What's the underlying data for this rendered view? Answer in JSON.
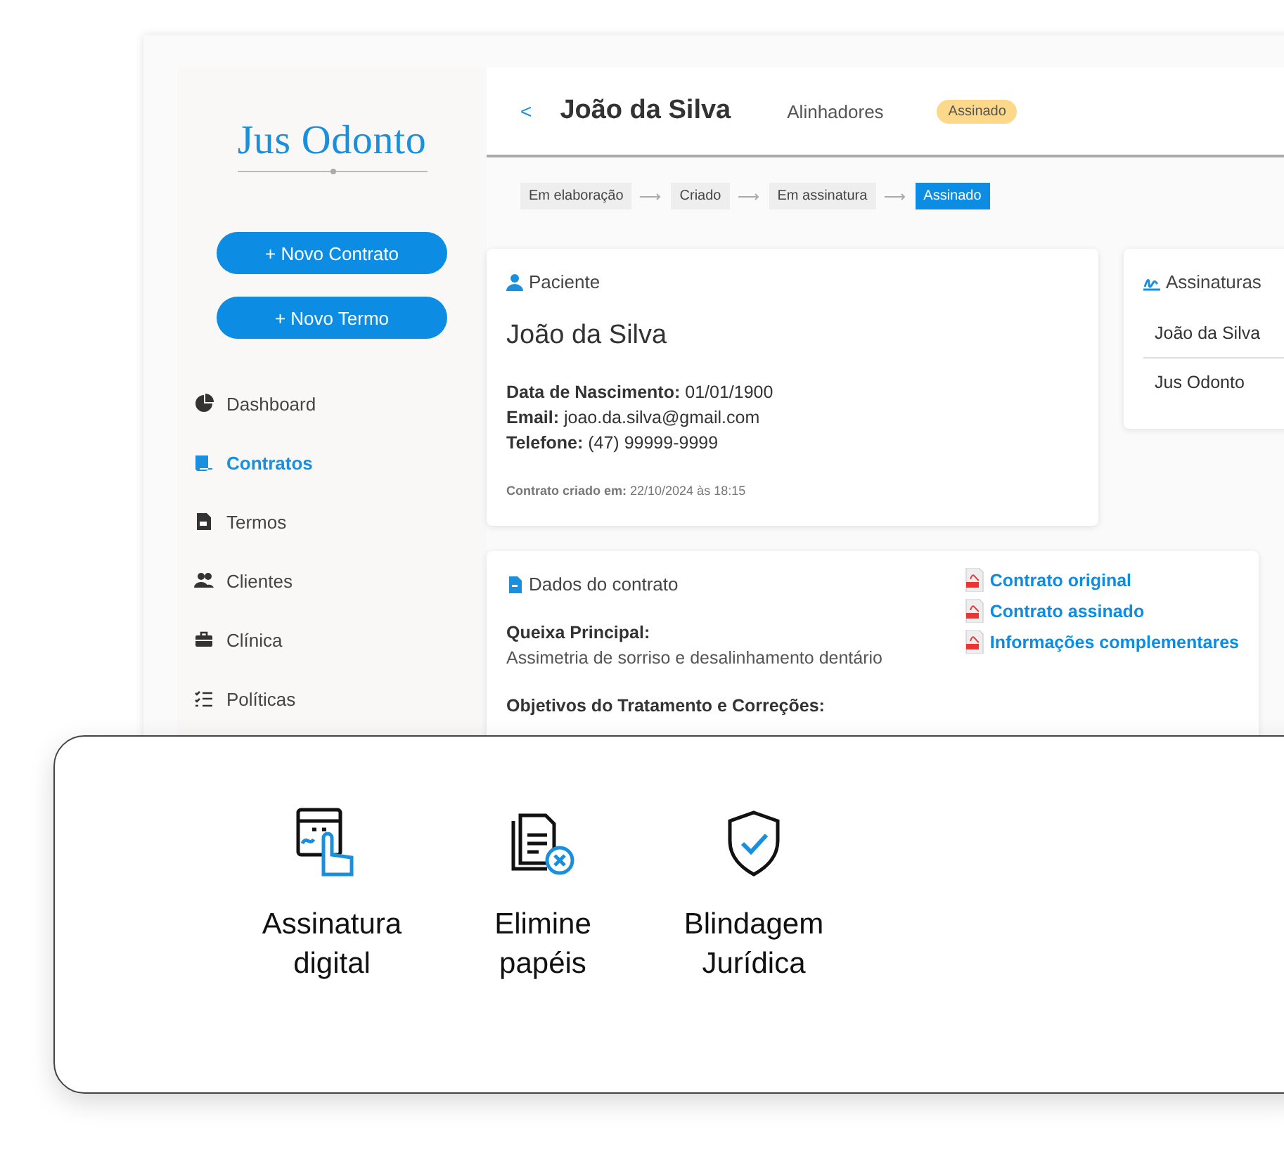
{
  "sidebar": {
    "logo": "Jus Odonto",
    "buttons": [
      "+ Novo Contrato",
      "+ Novo Termo"
    ],
    "items": [
      {
        "label": "Dashboard",
        "selected": false
      },
      {
        "label": "Contratos",
        "selected": true
      },
      {
        "label": "Termos",
        "selected": false
      },
      {
        "label": "Clientes",
        "selected": false
      },
      {
        "label": "Clínica",
        "selected": false
      },
      {
        "label": "Políticas",
        "selected": false
      }
    ]
  },
  "header": {
    "back": "<",
    "title": "João da Silva",
    "subtitle": "Alinhadores",
    "status": "Assinado"
  },
  "steps": [
    {
      "label": "Em elaboração",
      "selected": false
    },
    {
      "label": "Criado",
      "selected": false
    },
    {
      "label": "Em assinatura",
      "selected": false
    },
    {
      "label": "Assinado",
      "selected": true
    }
  ],
  "patient": {
    "heading": "Paciente",
    "name": "João da Silva",
    "fields": [
      "**Data de Nascimento:** 01/01/1900",
      "**Email:** joao.da.silva@gmail.com",
      "**Telefone:** (47) 99999-9999"
    ],
    "created": "**Contrato criado em:** 22/10/2024 às 18:15"
  },
  "signatures": {
    "heading": "Assinaturas",
    "signers": [
      "João da Silva",
      "Jus Odonto"
    ]
  },
  "contract": {
    "heading": "Dados do contrato",
    "sections": [
      {
        "title": "Queixa Principal:",
        "text": "Assimetria de sorriso e desalinhamento dentário"
      },
      {
        "title": "Objetivos do Tratamento e Correções:"
      }
    ],
    "files": [
      "Contrato original",
      "Contrato assinado",
      "Informações complementares"
    ]
  },
  "features": [
    {
      "label": "Assinatura digital"
    },
    {
      "label": "Elimine papéis"
    },
    {
      "label": "Blindagem Jurídica"
    }
  ]
}
